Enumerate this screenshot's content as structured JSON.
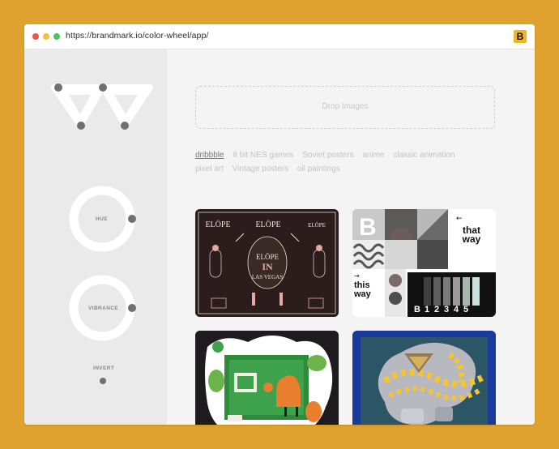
{
  "browser": {
    "url": "https://brandmark.io/color-wheel/app/",
    "extension_letter": "B",
    "traffic_lights": [
      "#F0534B",
      "#F2C043",
      "#49C657"
    ]
  },
  "sidebar": {
    "hue_label": "HUE",
    "vibrance_label": "VIBRANCE",
    "invert_label": "INVERT"
  },
  "main": {
    "dropzone_text": "Drop Images",
    "tags": [
      {
        "label": "dribbble",
        "active": true
      },
      {
        "label": "8 bit NES games",
        "active": false
      },
      {
        "label": "Soviet posters",
        "active": false
      },
      {
        "label": "anime",
        "active": false
      },
      {
        "label": "classic animation",
        "active": false
      },
      {
        "label": "pixel art",
        "active": false
      },
      {
        "label": "Vintage posters",
        "active": false
      },
      {
        "label": "oil paintings",
        "active": false
      }
    ],
    "thumbnails": [
      {
        "name": "elope-in-las-vegas",
        "text": [
          "ELÖPE",
          "IN",
          "LAS VEGAS"
        ]
      },
      {
        "name": "that-way-this-way",
        "text": [
          "that way",
          "this way",
          "B",
          "1",
          "2",
          "3",
          "4",
          "5"
        ]
      },
      {
        "name": "green-illustration",
        "text": []
      },
      {
        "name": "abstract-shapes",
        "text": []
      }
    ]
  },
  "colors": {
    "background": "#E0A22F",
    "window": "#F4F4F4",
    "sidebar": "#EAEAEA",
    "knob": "#707070"
  }
}
